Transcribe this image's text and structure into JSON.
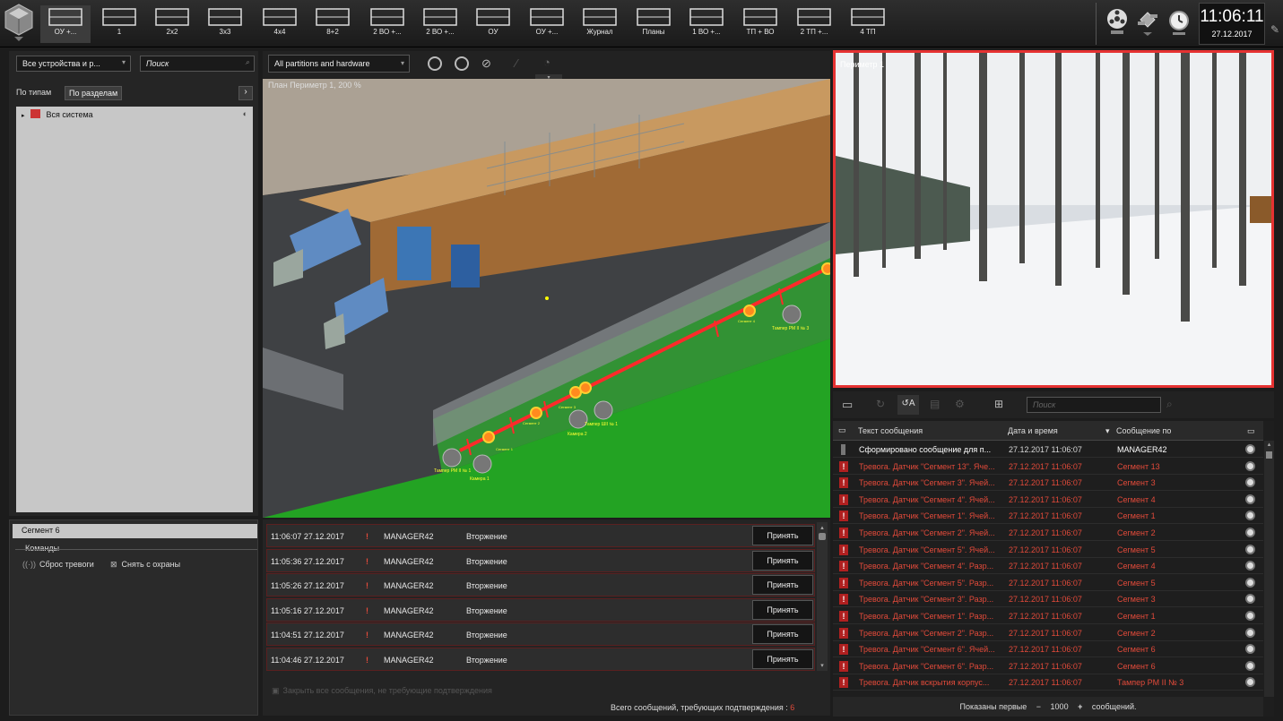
{
  "topbar": {
    "layouts": [
      {
        "label": "ОУ +...",
        "icon": "layout-custom-icon",
        "selected": true
      },
      {
        "label": "1",
        "icon": "layout-1-icon"
      },
      {
        "label": "2x2",
        "icon": "layout-2x2-icon"
      },
      {
        "label": "3x3",
        "icon": "layout-3x3-icon"
      },
      {
        "label": "4x4",
        "icon": "layout-4x4-icon"
      },
      {
        "label": "8+2",
        "icon": "layout-8plus2-icon"
      },
      {
        "label": "2 ВО +...",
        "icon": "layout-2vo-icon"
      },
      {
        "label": "2 ВО +...",
        "icon": "layout-2vo-icon"
      },
      {
        "label": "ОУ",
        "icon": "layout-ou-icon"
      },
      {
        "label": "ОУ +...",
        "icon": "layout-ou-plus-icon"
      },
      {
        "label": "Журнал",
        "icon": "layout-journal-icon"
      },
      {
        "label": "Планы",
        "icon": "layout-plans-icon"
      },
      {
        "label": "1 ВО +...",
        "icon": "layout-1vo-icon"
      },
      {
        "label": "ТП + ВО",
        "icon": "layout-tp-vo-icon"
      },
      {
        "label": "2 ТП +...",
        "icon": "layout-2tp-icon"
      },
      {
        "label": "4 ТП",
        "icon": "layout-4tp-icon"
      }
    ],
    "clock": {
      "time": "11:06:11",
      "date": "27.12.2017"
    }
  },
  "left": {
    "devices_dropdown": "Все устройства и р...",
    "search_placeholder": "Поиск",
    "tab_types": "По типам",
    "tab_sections": "По разделам",
    "tree_root": "Вся система"
  },
  "segment": {
    "title": "Сегмент 6",
    "commands_label": "Команды",
    "cmd_reset": "Сброс тревоги",
    "cmd_disarm": "Снять с охраны"
  },
  "map": {
    "partitions_dropdown": "All partitions and hardware",
    "plan_title": "План Периметр 1, 200 %",
    "labels": [
      "Тампер РМ II № 1",
      "Камера 1",
      "Камера 2",
      "Тампер ШII № 1",
      "Тампер РМ II № 3",
      "Сегмент 1",
      "Сегмент 2",
      "Сегмент 3",
      "Сегмент 4"
    ]
  },
  "events": {
    "rows": [
      {
        "time": "11:06:07 27.12.2017",
        "source": "MANAGER42",
        "type": "Вторжение",
        "action": "Принять"
      },
      {
        "time": "11:05:36 27.12.2017",
        "source": "MANAGER42",
        "type": "Вторжение",
        "action": "Принять"
      },
      {
        "time": "11:05:26 27.12.2017",
        "source": "MANAGER42",
        "type": "Вторжение",
        "action": "Принять"
      },
      {
        "time": "11:05:16 27.12.2017",
        "source": "MANAGER42",
        "type": "Вторжение",
        "action": "Принять"
      },
      {
        "time": "11:04:51 27.12.2017",
        "source": "MANAGER42",
        "type": "Вторжение",
        "action": "Принять"
      },
      {
        "time": "11:04:46 27.12.2017",
        "source": "MANAGER42",
        "type": "Вторжение",
        "action": "Принять"
      }
    ],
    "close_all": "Закрыть все сообщения, не требующие подтверждения",
    "total_label": "Всего сообщений, требующих подтверждения :",
    "total_count": "6"
  },
  "video": {
    "camera_title": "Периметр 1"
  },
  "messages": {
    "search_placeholder": "Поиск",
    "col_text": "Текст сообщения",
    "col_date": "Дата и время",
    "col_source": "Сообщение по",
    "rows": [
      {
        "text": "Сформировано сообщение для п...",
        "date": "27.12.2017 11:06:07",
        "source": "MANAGER42",
        "alarm": false
      },
      {
        "text": "Тревога. Датчик \"Сегмент 13\". Яче...",
        "date": "27.12.2017 11:06:07",
        "source": "Сегмент 13",
        "alarm": true
      },
      {
        "text": "Тревога. Датчик \"Сегмент 3\". Ячей...",
        "date": "27.12.2017 11:06:07",
        "source": "Сегмент 3",
        "alarm": true
      },
      {
        "text": "Тревога. Датчик \"Сегмент 4\". Ячей...",
        "date": "27.12.2017 11:06:07",
        "source": "Сегмент 4",
        "alarm": true
      },
      {
        "text": "Тревога. Датчик \"Сегмент 1\". Ячей...",
        "date": "27.12.2017 11:06:07",
        "source": "Сегмент 1",
        "alarm": true
      },
      {
        "text": "Тревога. Датчик \"Сегмент 2\". Ячей...",
        "date": "27.12.2017 11:06:07",
        "source": "Сегмент 2",
        "alarm": true
      },
      {
        "text": "Тревога. Датчик \"Сегмент 5\". Ячей...",
        "date": "27.12.2017 11:06:07",
        "source": "Сегмент 5",
        "alarm": true
      },
      {
        "text": "Тревога. Датчик \"Сегмент 4\". Разр...",
        "date": "27.12.2017 11:06:07",
        "source": "Сегмент 4",
        "alarm": true
      },
      {
        "text": "Тревога. Датчик \"Сегмент 5\". Разр...",
        "date": "27.12.2017 11:06:07",
        "source": "Сегмент 5",
        "alarm": true
      },
      {
        "text": "Тревога. Датчик \"Сегмент 3\". Разр...",
        "date": "27.12.2017 11:06:07",
        "source": "Сегмент 3",
        "alarm": true
      },
      {
        "text": "Тревога. Датчик \"Сегмент 1\". Разр...",
        "date": "27.12.2017 11:06:07",
        "source": "Сегмент 1",
        "alarm": true
      },
      {
        "text": "Тревога. Датчик \"Сегмент 2\". Разр...",
        "date": "27.12.2017 11:06:07",
        "source": "Сегмент 2",
        "alarm": true
      },
      {
        "text": "Тревога. Датчик \"Сегмент 6\". Ячей...",
        "date": "27.12.2017 11:06:07",
        "source": "Сегмент 6",
        "alarm": true
      },
      {
        "text": "Тревога. Датчик \"Сегмент 6\". Разр...",
        "date": "27.12.2017 11:06:07",
        "source": "Сегмент 6",
        "alarm": true
      },
      {
        "text": "Тревога. Датчик вскрытия корпус...",
        "date": "27.12.2017 11:06:07",
        "source": "Тампер РМ II № 3",
        "alarm": true
      }
    ],
    "footer_prefix": "Показаны первые",
    "footer_minus": "−",
    "footer_count": "1000",
    "footer_plus": "+",
    "footer_suffix": "сообщений."
  },
  "colors": {
    "alarm": "#e24a3a",
    "accent_border": "#e53232",
    "ground": "#23a323"
  }
}
